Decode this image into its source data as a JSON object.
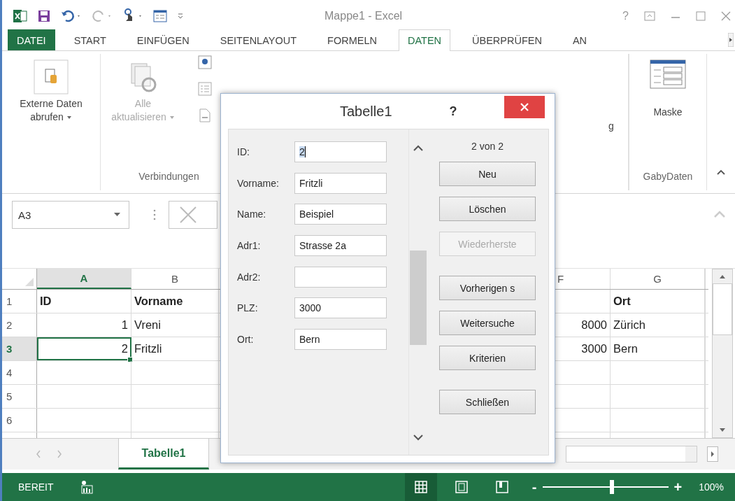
{
  "window": {
    "title": "Mappe1 - Excel",
    "help": "?"
  },
  "ribbon_tabs": [
    {
      "label": "DATEI",
      "kind": "file",
      "selected": false
    },
    {
      "label": "START",
      "kind": "tab",
      "selected": false
    },
    {
      "label": "EINFÜGEN",
      "kind": "tab",
      "selected": false
    },
    {
      "label": "SEITENLAYOUT",
      "kind": "tab",
      "selected": false
    },
    {
      "label": "FORMELN",
      "kind": "tab",
      "selected": false
    },
    {
      "label": "DATEN",
      "kind": "tab",
      "selected": true
    },
    {
      "label": "ÜBERPRÜFEN",
      "kind": "tab",
      "selected": false
    },
    {
      "label": "AN",
      "kind": "tab",
      "selected": false
    }
  ],
  "ribbon": {
    "left_buttons": [
      {
        "label": "Externe Daten abrufen",
        "disabled": false
      },
      {
        "label": "Alle aktualisieren",
        "disabled": true
      }
    ],
    "left_group_label": "Verbindungen",
    "cut_text": "g",
    "right_button": "Maske",
    "right_group_label": "GabyDaten"
  },
  "formula_bar": {
    "name_box": "A3"
  },
  "columns": [
    {
      "label": "A",
      "selected": true
    },
    {
      "label": "B",
      "selected": false
    },
    {
      "label": "F",
      "selected": false
    },
    {
      "label": "G",
      "selected": false
    }
  ],
  "rows": [
    {
      "label": "1",
      "selected": false,
      "bold": true,
      "col_a": {
        "text": "ID",
        "kind": "text"
      },
      "col_b": {
        "text": "Vorname",
        "kind": "text"
      },
      "col_g": {
        "text": "Ort",
        "kind": "text"
      }
    },
    {
      "label": "2",
      "selected": false,
      "bold": false,
      "col_a": {
        "text": "1",
        "kind": "number"
      },
      "col_b": {
        "text": "Vreni",
        "kind": "text"
      },
      "col_f": {
        "text": "8000",
        "kind": "number"
      },
      "col_g": {
        "text": "Zürich",
        "kind": "text"
      }
    },
    {
      "label": "3",
      "selected": true,
      "bold": false,
      "col_a": {
        "text": "2",
        "kind": "number"
      },
      "col_b": {
        "text": "Fritzli",
        "kind": "text"
      },
      "col_f": {
        "text": "3000",
        "kind": "number"
      },
      "col_g": {
        "text": "Bern",
        "kind": "text"
      }
    },
    {
      "label": "4",
      "selected": false
    },
    {
      "label": "5",
      "selected": false
    },
    {
      "label": "6",
      "selected": false
    }
  ],
  "sheet_tabs": [
    {
      "label": "Tabelle1",
      "selected": true
    }
  ],
  "status_bar": {
    "text": "BEREIT",
    "views": [
      {
        "kind": "normal",
        "selected": true
      },
      {
        "kind": "page_layout",
        "selected": false
      },
      {
        "kind": "page_break",
        "selected": false
      }
    ],
    "zoom_out": "-",
    "zoom_in": "+",
    "zoom": {
      "level": 0.55,
      "reading": "100%"
    }
  },
  "dialog": {
    "title": "Tabelle1",
    "help": "?",
    "fields": [
      {
        "label": "ID:",
        "value": "2",
        "selected": true
      },
      {
        "label": "Vorname:",
        "value": "Fritzli",
        "selected": false
      },
      {
        "label": "Name:",
        "value": "Beispiel",
        "selected": false
      },
      {
        "label": "Adr1:",
        "value": "Strasse 2a",
        "selected": false
      },
      {
        "label": "Adr2:",
        "selected": false
      },
      {
        "label": "PLZ:",
        "value": "3000",
        "selected": false
      },
      {
        "label": "Ort:",
        "value": "Bern",
        "selected": false
      }
    ],
    "record": "2 von 2",
    "button_groups": [
      {
        "buttons": [
          {
            "label": "Neu",
            "disabled": false
          },
          {
            "label": "Löschen",
            "disabled": false
          },
          {
            "label": "Wiederherste",
            "disabled": true
          }
        ]
      },
      {
        "buttons": [
          {
            "label": "Vorherigen s",
            "disabled": false
          },
          {
            "label": "Weitersuche",
            "disabled": false
          },
          {
            "label": "Kriterien",
            "disabled": false
          }
        ]
      },
      {
        "buttons": [
          {
            "label": "Schließen",
            "disabled": false
          }
        ]
      }
    ]
  }
}
